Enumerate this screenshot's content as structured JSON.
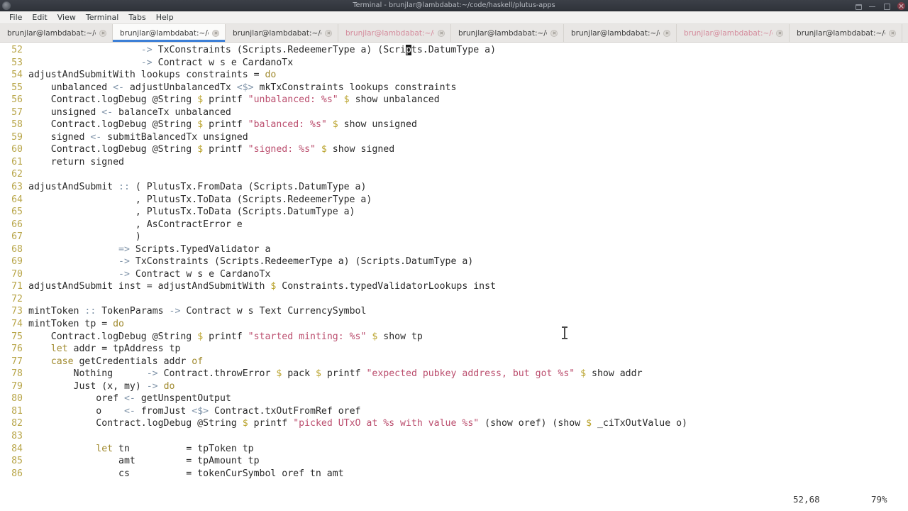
{
  "window": {
    "title": "Terminal - brunjlar@lambdabat:~/code/haskell/plutus-apps",
    "icon_name": "terminal-app-icon",
    "controls": [
      {
        "name": "shade-button",
        "label": "Shade"
      },
      {
        "name": "minimize-button",
        "label": "Minimize"
      },
      {
        "name": "maximize-button",
        "label": "Maximize"
      },
      {
        "name": "close-button",
        "label": "Close"
      }
    ]
  },
  "menubar": {
    "items": [
      {
        "label": "File"
      },
      {
        "label": "Edit"
      },
      {
        "label": "View"
      },
      {
        "label": "Terminal"
      },
      {
        "label": "Tabs"
      },
      {
        "label": "Help"
      }
    ]
  },
  "tabs": [
    {
      "label": "brunjlar@lambdabat:~/co...",
      "active": false,
      "bell": false
    },
    {
      "label": "brunjlar@lambdabat:~/co...",
      "active": true,
      "bell": false
    },
    {
      "label": "brunjlar@lambdabat:~/co...",
      "active": false,
      "bell": false
    },
    {
      "label": "brunjlar@lambdabat:~/co...",
      "active": false,
      "bell": true
    },
    {
      "label": "brunjlar@lambdabat:~/co...",
      "active": false,
      "bell": false
    },
    {
      "label": "brunjlar@lambdabat:~/co...",
      "active": false,
      "bell": false
    },
    {
      "label": "brunjlar@lambdabat:~/co...",
      "active": false,
      "bell": true
    },
    {
      "label": "brunjlar@lambdabat:~/co...",
      "active": false,
      "bell": false
    }
  ],
  "editor": {
    "first_line": 52,
    "cursor_line": 52,
    "cursor_column": 68,
    "lines": [
      {
        "n": 52,
        "text": "                    -> TxConstraints (Scripts.RedeemerType a) (Scripts.DatumType a)"
      },
      {
        "n": 53,
        "text": "                    -> Contract w s e CardanoTx"
      },
      {
        "n": 54,
        "text": "adjustAndSubmitWith lookups constraints = do"
      },
      {
        "n": 55,
        "text": "    unbalanced <- adjustUnbalancedTx <$> mkTxConstraints lookups constraints"
      },
      {
        "n": 56,
        "text": "    Contract.logDebug @String $ printf \"unbalanced: %s\" $ show unbalanced"
      },
      {
        "n": 57,
        "text": "    unsigned <- balanceTx unbalanced"
      },
      {
        "n": 58,
        "text": "    Contract.logDebug @String $ printf \"balanced: %s\" $ show unsigned"
      },
      {
        "n": 59,
        "text": "    signed <- submitBalancedTx unsigned"
      },
      {
        "n": 60,
        "text": "    Contract.logDebug @String $ printf \"signed: %s\" $ show signed"
      },
      {
        "n": 61,
        "text": "    return signed"
      },
      {
        "n": 62,
        "text": ""
      },
      {
        "n": 63,
        "text": "adjustAndSubmit :: ( PlutusTx.FromData (Scripts.DatumType a)"
      },
      {
        "n": 64,
        "text": "                   , PlutusTx.ToData (Scripts.RedeemerType a)"
      },
      {
        "n": 65,
        "text": "                   , PlutusTx.ToData (Scripts.DatumType a)"
      },
      {
        "n": 66,
        "text": "                   , AsContractError e"
      },
      {
        "n": 67,
        "text": "                   )"
      },
      {
        "n": 68,
        "text": "                => Scripts.TypedValidator a"
      },
      {
        "n": 69,
        "text": "                -> TxConstraints (Scripts.RedeemerType a) (Scripts.DatumType a)"
      },
      {
        "n": 70,
        "text": "                -> Contract w s e CardanoTx"
      },
      {
        "n": 71,
        "text": "adjustAndSubmit inst = adjustAndSubmitWith $ Constraints.typedValidatorLookups inst"
      },
      {
        "n": 72,
        "text": ""
      },
      {
        "n": 73,
        "text": "mintToken :: TokenParams -> Contract w s Text CurrencySymbol"
      },
      {
        "n": 74,
        "text": "mintToken tp = do"
      },
      {
        "n": 75,
        "text": "    Contract.logDebug @String $ printf \"started minting: %s\" $ show tp"
      },
      {
        "n": 76,
        "text": "    let addr = tpAddress tp"
      },
      {
        "n": 77,
        "text": "    case getCredentials addr of"
      },
      {
        "n": 78,
        "text": "        Nothing      -> Contract.throwError $ pack $ printf \"expected pubkey address, but got %s\" $ show addr"
      },
      {
        "n": 79,
        "text": "        Just (x, my) -> do"
      },
      {
        "n": 80,
        "text": "            oref <- getUnspentOutput"
      },
      {
        "n": 81,
        "text": "            o    <- fromJust <$> Contract.txOutFromRef oref"
      },
      {
        "n": 82,
        "text": "            Contract.logDebug @String $ printf \"picked UTxO at %s with value %s\" (show oref) (show $ _ciTxOutValue o)"
      },
      {
        "n": 83,
        "text": ""
      },
      {
        "n": 84,
        "text": "            let tn          = tpToken tp"
      },
      {
        "n": 85,
        "text": "                amt         = tpAmount tp"
      },
      {
        "n": 86,
        "text": "                cs          = tokenCurSymbol oref tn amt"
      }
    ]
  },
  "statusbar": {
    "position": "52,68",
    "percent": "79%"
  },
  "colors": {
    "accent": "#3d7fd6",
    "linenum": "#b8a548",
    "keyword": "#a08a2e",
    "operator": "#7f93a8",
    "dollar": "#b9a22a",
    "string": "#bb4e6e",
    "text": "#2a2a2a",
    "titlebar": "#2f333a",
    "tabbar": "#e8e6e4"
  }
}
